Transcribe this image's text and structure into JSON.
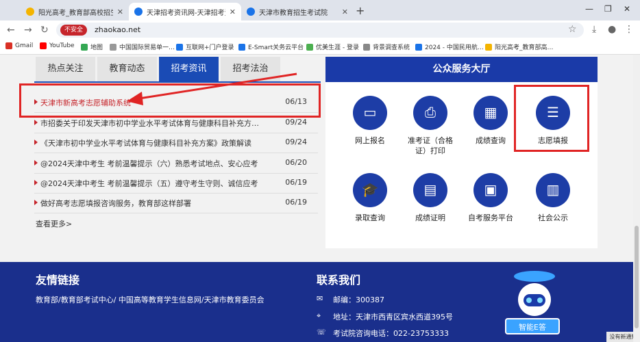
{
  "browser": {
    "tabs": [
      {
        "title": "阳光高考_教育部高校招生阳光…",
        "fav": "#f4b400"
      },
      {
        "title": "天津招考资讯网-天津招考资讯…",
        "fav": "#1a73e8"
      },
      {
        "title": "天津市教育招生考试院",
        "fav": "#1a73e8"
      }
    ],
    "new_tab": "+",
    "insecure_label": "不安全",
    "url": "zhaokao.net",
    "bookmarks": [
      {
        "label": "Gmail"
      },
      {
        "label": "YouTube"
      },
      {
        "label": "地图"
      },
      {
        "label": "中国国际贸易单一…"
      },
      {
        "label": "互联网+门户登录"
      },
      {
        "label": "E-Smart关务云平台"
      },
      {
        "label": "优美生涯 - 登录"
      },
      {
        "label": "背景调查系统"
      },
      {
        "label": "2024 - 中国民用航…"
      },
      {
        "label": "阳光高考_教育部高…"
      }
    ]
  },
  "news": {
    "tabs": [
      "热点关注",
      "教育动态",
      "招考资讯",
      "招考法治"
    ],
    "items": [
      {
        "title": "天津市新高考志愿辅助系统",
        "date": "06/13"
      },
      {
        "title": "市招委关于印发天津市初中学业水平考试体育与健康科目补充方…",
        "date": "09/24"
      },
      {
        "title": "《天津市初中学业水平考试体育与健康科目补充方案》政策解读",
        "date": "09/24"
      },
      {
        "title": "@2024天津中考生 考前温馨提示（六）熟悉考试地点、安心应考",
        "date": "06/20"
      },
      {
        "title": "@2024天津中考生 考前温馨提示（五）遵守考生守则、诚信应考",
        "date": "06/19"
      },
      {
        "title": "做好高考志愿填报咨询服务，教育部这样部署",
        "date": "06/19"
      }
    ],
    "more": "查看更多>"
  },
  "services": {
    "title": "公众服务大厅",
    "items": [
      {
        "label": "网上报名",
        "icon": "monitor-icon"
      },
      {
        "label": "准考证（合格证）打印",
        "icon": "printer-icon"
      },
      {
        "label": "成绩查询",
        "icon": "score-icon"
      },
      {
        "label": "志愿填报",
        "icon": "volunteer-icon"
      },
      {
        "label": "录取查询",
        "icon": "graduation-cap-icon"
      },
      {
        "label": "成绩证明",
        "icon": "certificate-icon"
      },
      {
        "label": "自考服务平台",
        "icon": "self-exam-icon"
      },
      {
        "label": "社会公示",
        "icon": "clipboard-icon"
      }
    ]
  },
  "footer": {
    "links_title": "友情链接",
    "links": "教育部/教育部考试中心/ 中国高等教育学生信息网/天津市教育委员会",
    "contact_title": "联系我们",
    "postcode": "邮编：300387",
    "address": "地址：天津市西青区宾水西道395号",
    "phone": "考试院咨询电话：022-23753333",
    "robot_label": "智能E答",
    "notify": "没有新通知"
  }
}
